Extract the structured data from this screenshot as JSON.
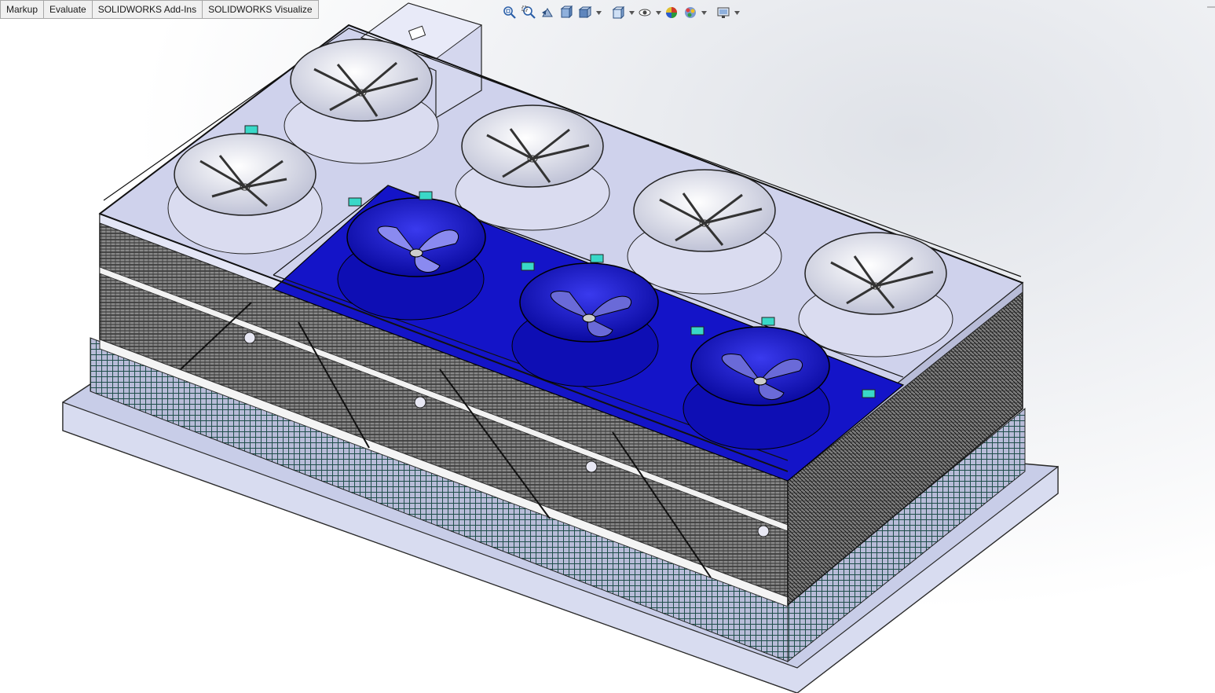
{
  "command_tabs": [
    "Markup",
    "Evaluate",
    "SOLIDWORKS Add-Ins",
    "SOLIDWORKS Visualize"
  ],
  "heads_up_toolbar": {
    "icons": [
      "zoom-to-fit-icon",
      "zoom-to-area-icon",
      "previous-view-icon",
      "section-view-icon",
      "view-orientation-icon",
      "display-style-icon",
      "hide-show-items-icon",
      "edit-appearance-icon",
      "apply-scene-icon",
      "view-settings-icon"
    ]
  },
  "model": {
    "name": "cooling-tower-assembly",
    "colors": {
      "background_top": "#dfe2e8",
      "top_deck": "#cfd2ec",
      "blue_panel": "#1414c8",
      "base_frame": "#c8cde8",
      "louver_face": "#6a6a6a"
    }
  }
}
